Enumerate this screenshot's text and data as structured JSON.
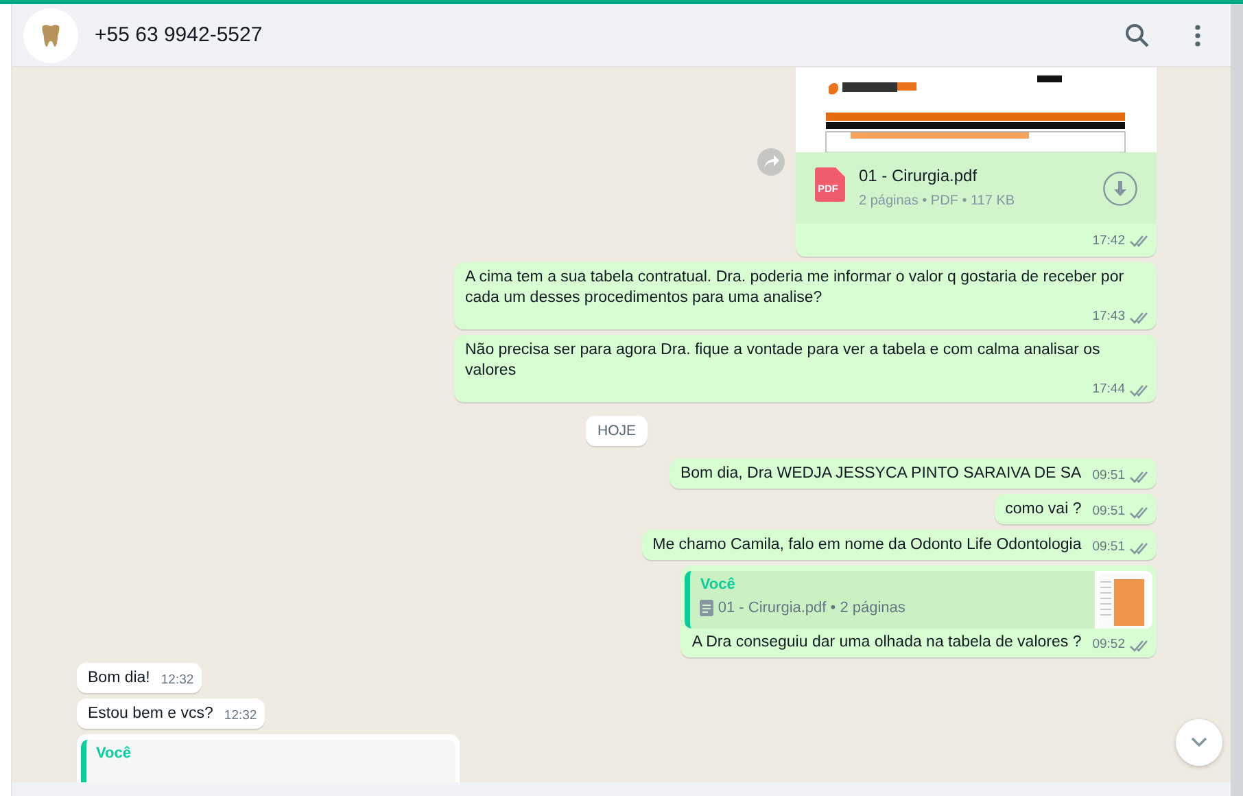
{
  "header": {
    "title": "+55 63 9942-5527"
  },
  "messages": [
    {
      "kind": "document",
      "outgoing": true,
      "file_name": "01 - Cirurgia.pdf",
      "file_type": "PDF",
      "file_info": "2 páginas • PDF • 117 KB",
      "time": "17:42",
      "read": false
    },
    {
      "kind": "text",
      "outgoing": true,
      "text": "A cima tem a sua tabela contratual. Dra. poderia me informar o valor q gostaria de receber por cada um desses procedimentos para uma analise?",
      "time": "17:43",
      "read": false
    },
    {
      "kind": "text",
      "outgoing": true,
      "text": "Não precisa ser para agora Dra. fique a vontade para ver a tabela  e com calma analisar os valores",
      "time": "17:44",
      "read": false
    },
    {
      "kind": "date",
      "text": "HOJE"
    },
    {
      "kind": "text",
      "outgoing": true,
      "text": "Bom dia, Dra WEDJA JESSYCA PINTO SARAIVA DE SA",
      "time": "09:51",
      "read": false
    },
    {
      "kind": "text",
      "outgoing": true,
      "text": "como vai ?",
      "time": "09:51",
      "read": false
    },
    {
      "kind": "text",
      "outgoing": true,
      "text": "Me chamo Camila, falo em nome da Odonto Life Odontologia",
      "time": "09:51",
      "read": false
    },
    {
      "kind": "reply",
      "outgoing": true,
      "quote_author": "Você",
      "quote_text": "01 - Cirurgia.pdf • 2 páginas",
      "text": "A Dra conseguiu dar uma olhada na tabela de valores ?",
      "time": "09:52",
      "read": false
    },
    {
      "kind": "text",
      "outgoing": false,
      "text": "Bom dia!",
      "time": "12:32"
    },
    {
      "kind": "text",
      "outgoing": false,
      "text": "Estou bem e vcs?",
      "time": "12:32"
    },
    {
      "kind": "reply",
      "outgoing": false,
      "quote_author": "Você"
    }
  ]
}
